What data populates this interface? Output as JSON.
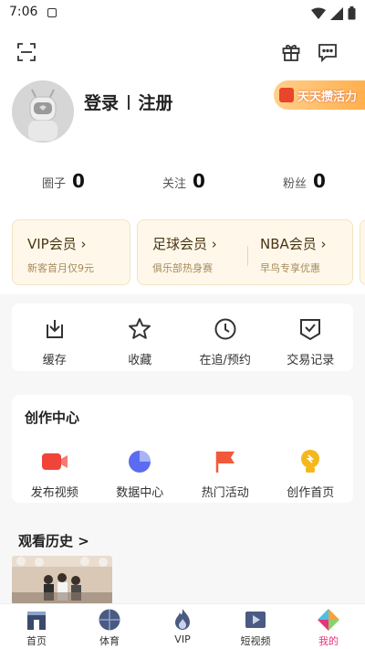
{
  "status_bar": {
    "time": "7:06",
    "app_icon": "a-icon",
    "icons": [
      "wifi-icon",
      "signal-icon",
      "battery-icon"
    ]
  },
  "top_bar": {
    "left_icon": "scan-icon",
    "right_icons": [
      "gift-icon",
      "message-icon"
    ]
  },
  "profile": {
    "login": "登录",
    "register": "注册",
    "promo_label": "天天攒活力"
  },
  "stats": [
    {
      "label": "圈子",
      "value": "0"
    },
    {
      "label": "关注",
      "value": "0"
    },
    {
      "label": "粉丝",
      "value": "0"
    }
  ],
  "memberships": {
    "vip": {
      "title": "VIP会员 ›",
      "subtitle": "新客首月仅9元"
    },
    "football": {
      "title": "足球会员 ›",
      "subtitle": "俱乐部热身赛"
    },
    "nba": {
      "title": "NBA会员 ›",
      "subtitle": "早鸟专享优惠"
    }
  },
  "quick_actions": [
    {
      "label": "缓存",
      "icon": "download-icon"
    },
    {
      "label": "收藏",
      "icon": "star-icon"
    },
    {
      "label": "在追/预约",
      "icon": "clock-icon"
    },
    {
      "label": "交易记录",
      "icon": "receipt-icon"
    }
  ],
  "creator_center": {
    "title": "创作中心",
    "items": [
      {
        "label": "发布视频",
        "icon": "video-camera-icon",
        "color": "#f0433a"
      },
      {
        "label": "数据中心",
        "icon": "pie-chart-icon",
        "color": "#5b6cf0"
      },
      {
        "label": "热门活动",
        "icon": "flag-icon",
        "color": "#f05a3a"
      },
      {
        "label": "创作首页",
        "icon": "lightbulb-icon",
        "color": "#f5b81c"
      }
    ]
  },
  "history": {
    "title": "观看历史 >"
  },
  "tab_bar": [
    {
      "label": "首页",
      "icon": "home-icon"
    },
    {
      "label": "体育",
      "icon": "sports-icon"
    },
    {
      "label": "VIP",
      "icon": "vip-flame-icon"
    },
    {
      "label": "短视频",
      "icon": "short-video-icon"
    },
    {
      "label": "我的",
      "icon": "profile-icon",
      "active": true
    }
  ],
  "colors": {
    "accent_active": "#e6347a",
    "member_bg": "#fff8ea",
    "promo": "#ffb04e"
  }
}
